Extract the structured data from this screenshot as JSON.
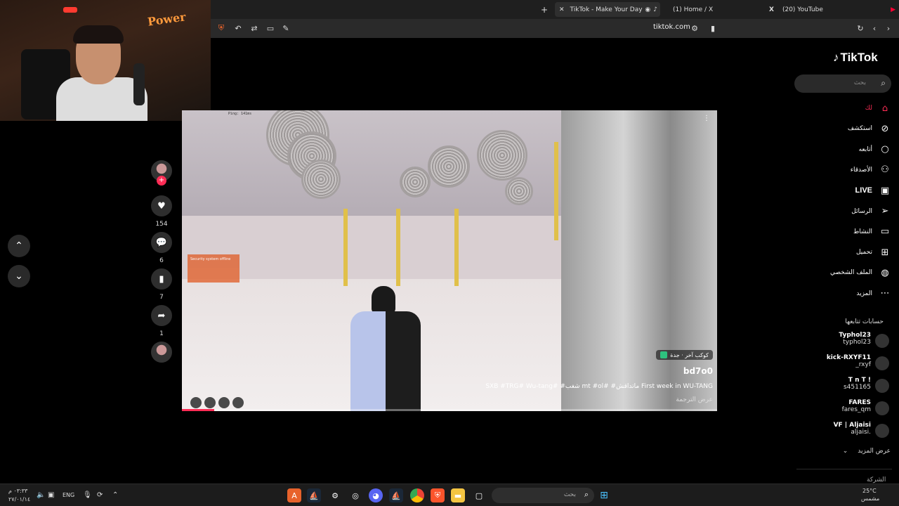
{
  "browser": {
    "tabs": [
      {
        "label": "TikTok - Make Your Day",
        "active": true
      },
      {
        "label": "(1) Home / X",
        "active": false
      },
      {
        "label": "(20) YouTube",
        "active": false
      }
    ],
    "new_tab_symbol": "+",
    "url": "tiktok.com"
  },
  "webcam": {
    "sign_text": "Power"
  },
  "actions": {
    "likes": "154",
    "comments": "6",
    "saves": "7",
    "shares": "1"
  },
  "video": {
    "ping": "Ping: 141ms",
    "overlay_text": "Security system offline",
    "effect_badge": "كوكب آخر · جدة",
    "author": "bd7o0",
    "caption": "SXB #TRG# Wu-tang# #شغب mt #ol# #ماتداقش First week in WU-TANG",
    "translate": "عرض الترجمة",
    "progress": 0.06
  },
  "sidebar": {
    "logo": "TikTok",
    "search_placeholder": "بحث",
    "nav": [
      {
        "icon": "home-icon",
        "label": "لك",
        "color": "#fe2c55"
      },
      {
        "icon": "compass-icon",
        "label": "استكشف"
      },
      {
        "icon": "circle-icon",
        "label": "أتابعه"
      },
      {
        "icon": "friends-icon",
        "label": "الأصدقاء"
      },
      {
        "icon": "live-icon",
        "label": "LIVE"
      },
      {
        "icon": "send-icon",
        "label": "الرسائل"
      },
      {
        "icon": "activity-icon",
        "label": "النشاط"
      },
      {
        "icon": "upload-icon",
        "label": "تحميل"
      },
      {
        "icon": "profile-icon",
        "label": "الملف الشخصي"
      },
      {
        "icon": "more-icon",
        "label": "المزيد"
      }
    ],
    "following_title": "حسابات تتابعها",
    "following": [
      {
        "name": "Typhol23",
        "username": "typhol23"
      },
      {
        "name": "kick-RXYF11",
        "username": "_rxyf"
      },
      {
        "name": "T n T !",
        "username": "s451165"
      },
      {
        "name": "FARES",
        "username": "fares_qm"
      },
      {
        "name": "VF | Aljaisi",
        "username": "aljaisi."
      }
    ],
    "see_more": "عرض المزيد",
    "cutoff_text": "الشركة"
  },
  "taskbar": {
    "search_placeholder": "بحث",
    "language": "ENG",
    "time": "٠٣:٣٣ م",
    "date": "٢٧/٠١/١٤",
    "temperature": "25°C",
    "weather": "مشمس"
  }
}
